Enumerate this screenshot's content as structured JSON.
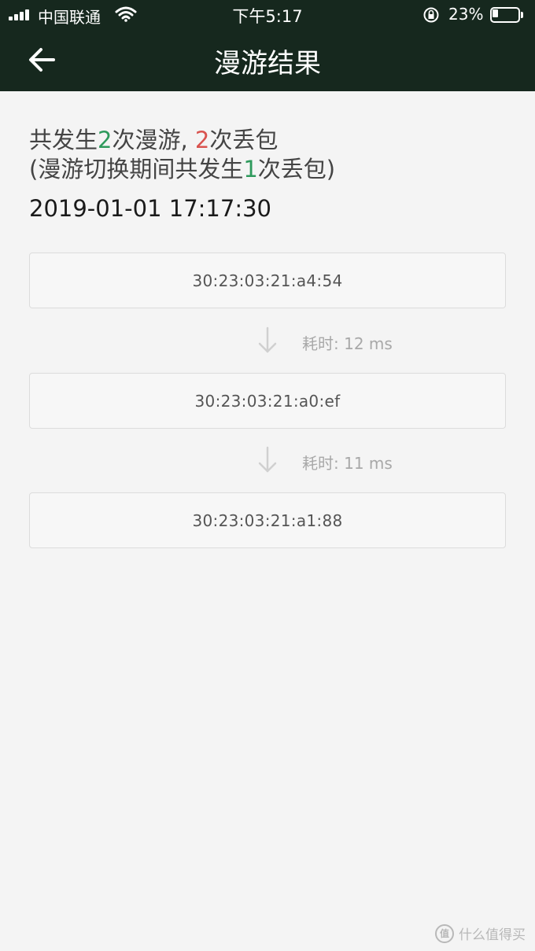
{
  "status_bar": {
    "carrier": "中国联通",
    "time": "下午5:17",
    "battery_percent": "23%",
    "battery_level": 0.23
  },
  "nav": {
    "title": "漫游结果",
    "back_icon": "back-arrow-icon"
  },
  "summary": {
    "line1_a": "共发生",
    "roam_count": "2",
    "line1_b": "次漫游, ",
    "loss_count": "2",
    "line1_c": "次丢包",
    "line2_a": "(漫游切换期间共发生",
    "switch_loss_count": "1",
    "line2_b": "次丢包)"
  },
  "timestamp": "2019-01-01 17:17:30",
  "access_points": [
    {
      "mac": "30:23:03:21:a4:54"
    },
    {
      "mac": "30:23:03:21:a0:ef"
    },
    {
      "mac": "30:23:03:21:a1:88"
    }
  ],
  "transitions": [
    {
      "label": "耗时: 12 ms"
    },
    {
      "label": "耗时: 11 ms"
    }
  ],
  "colors": {
    "header_bg": "#16281e",
    "accent_green": "#2e9a5c",
    "accent_red": "#d9534f"
  },
  "watermark": {
    "logo_text": "值",
    "text": "什么值得买"
  }
}
